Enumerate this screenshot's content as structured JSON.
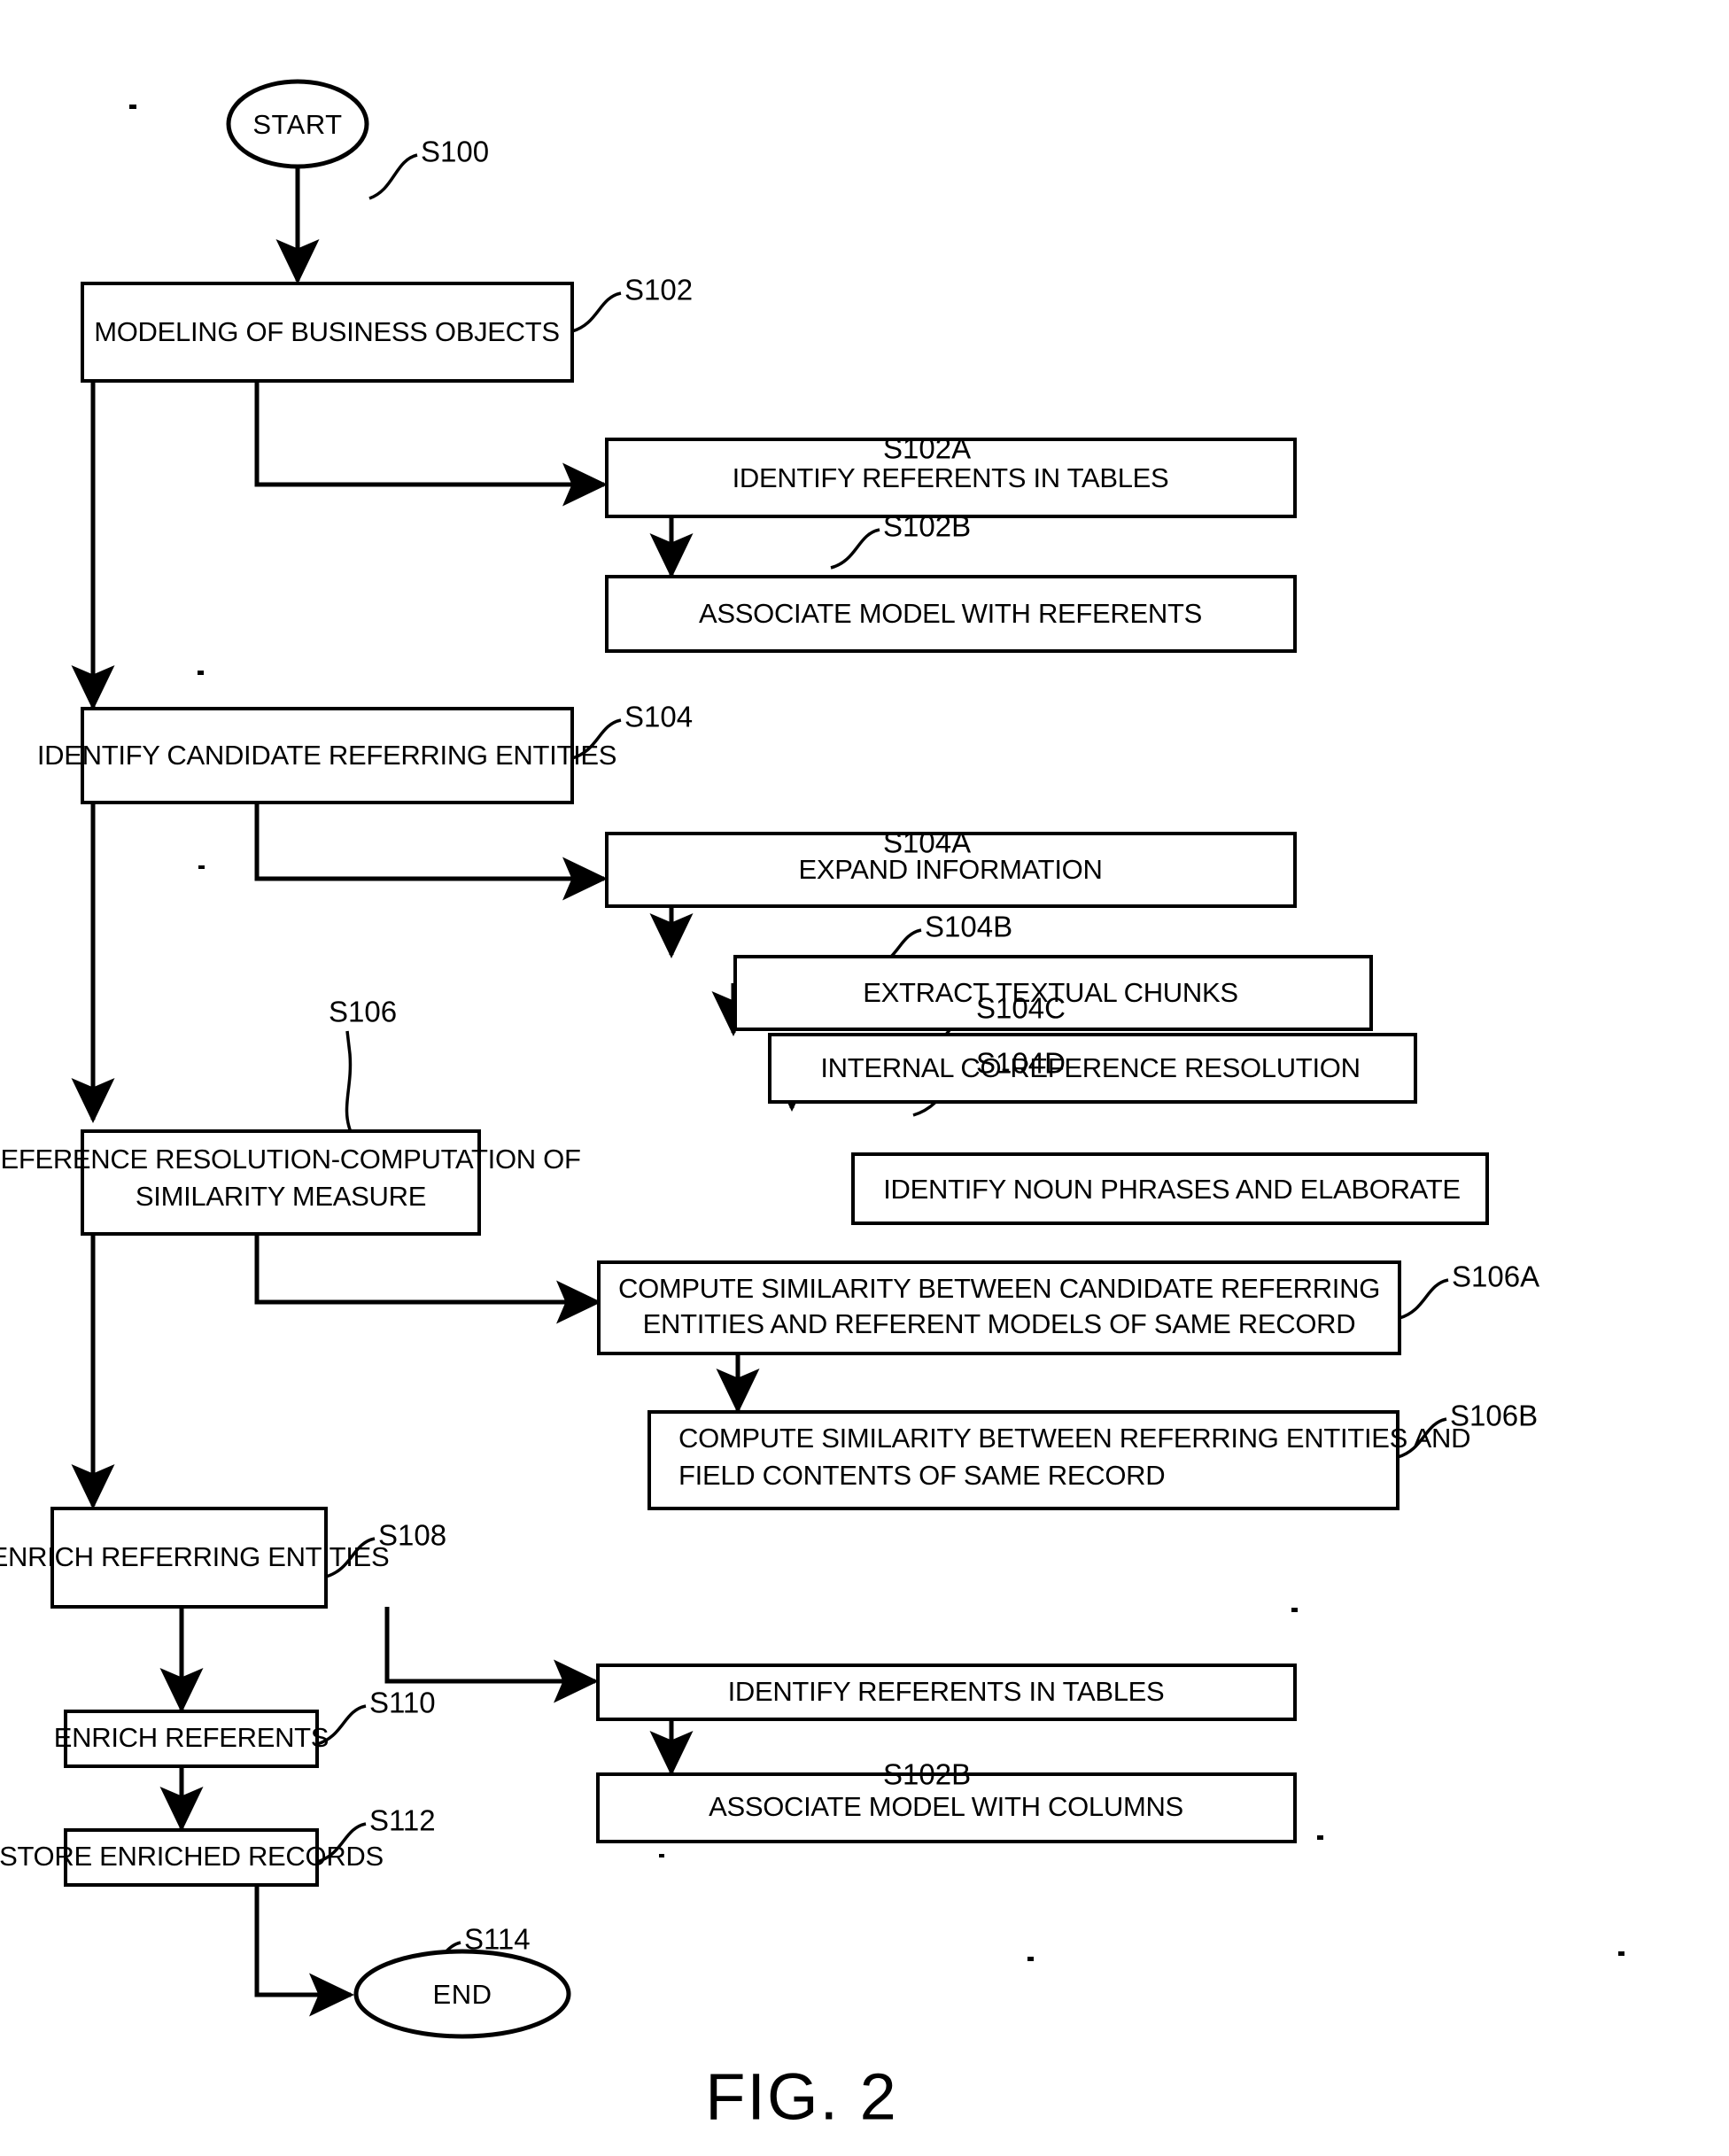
{
  "figure": {
    "caption": "FIG. 2",
    "start_label": "START",
    "end_label": "END"
  },
  "nodes": {
    "start": {
      "text": "START",
      "ref": "S100"
    },
    "modeling": {
      "text": "MODELING OF BUSINESS OBJECTS",
      "ref": "S102"
    },
    "identify_referents_tables_1": {
      "text": "IDENTIFY REFERENTS IN TABLES",
      "ref": "S102A"
    },
    "associate_model_referents": {
      "text": "ASSOCIATE MODEL WITH REFERENTS",
      "ref": "S102B"
    },
    "identify_candidate": {
      "text": "IDENTIFY CANDIDATE REFERRING ENTITIES",
      "ref": "S104"
    },
    "expand_information": {
      "text": "EXPAND INFORMATION",
      "ref": "S104A"
    },
    "extract_chunks": {
      "text": "EXTRACT TEXTUAL CHUNKS",
      "ref": "S104B"
    },
    "internal_coref": {
      "text": "INTERNAL CO-REFERENCE RESOLUTION",
      "ref": "S104C"
    },
    "identify_noun_phrases": {
      "text": "IDENTIFY NOUN PHRASES AND ELABORATE",
      "ref": "S104D"
    },
    "reference_resolution": {
      "line1": "REFERENCE RESOLUTION-COMPUTATION OF",
      "line2": "SIMILARITY MEASURE",
      "ref": "S106"
    },
    "compute_sim_a": {
      "line1": "COMPUTE SIMILARITY BETWEEN CANDIDATE REFERRING",
      "line2": "ENTITIES AND REFERENT MODELS OF SAME RECORD",
      "ref": "S106A"
    },
    "compute_sim_b": {
      "line1": "COMPUTE SIMILARITY BETWEEN REFERRING ENTITIES AND",
      "line2": "FIELD CONTENTS OF SAME RECORD",
      "ref": "S106B"
    },
    "enrich_referring": {
      "text": "ENRICH REFERRING ENTITIES",
      "ref": "S108"
    },
    "enrich_referents": {
      "text": "ENRICH REFERENTS",
      "ref": "S110"
    },
    "store_records": {
      "text": "STORE ENRICHED RECORDS",
      "ref": "S112"
    },
    "identify_referents_tables_2": {
      "text": "IDENTIFY REFERENTS IN TABLES",
      "ref": ""
    },
    "associate_model_columns": {
      "text": "ASSOCIATE MODEL WITH COLUMNS",
      "ref": "S102B"
    },
    "end": {
      "text": "END",
      "ref": "S114"
    }
  },
  "colors": {
    "line": "#000000",
    "fill": "#ffffff",
    "text": "#000000"
  }
}
